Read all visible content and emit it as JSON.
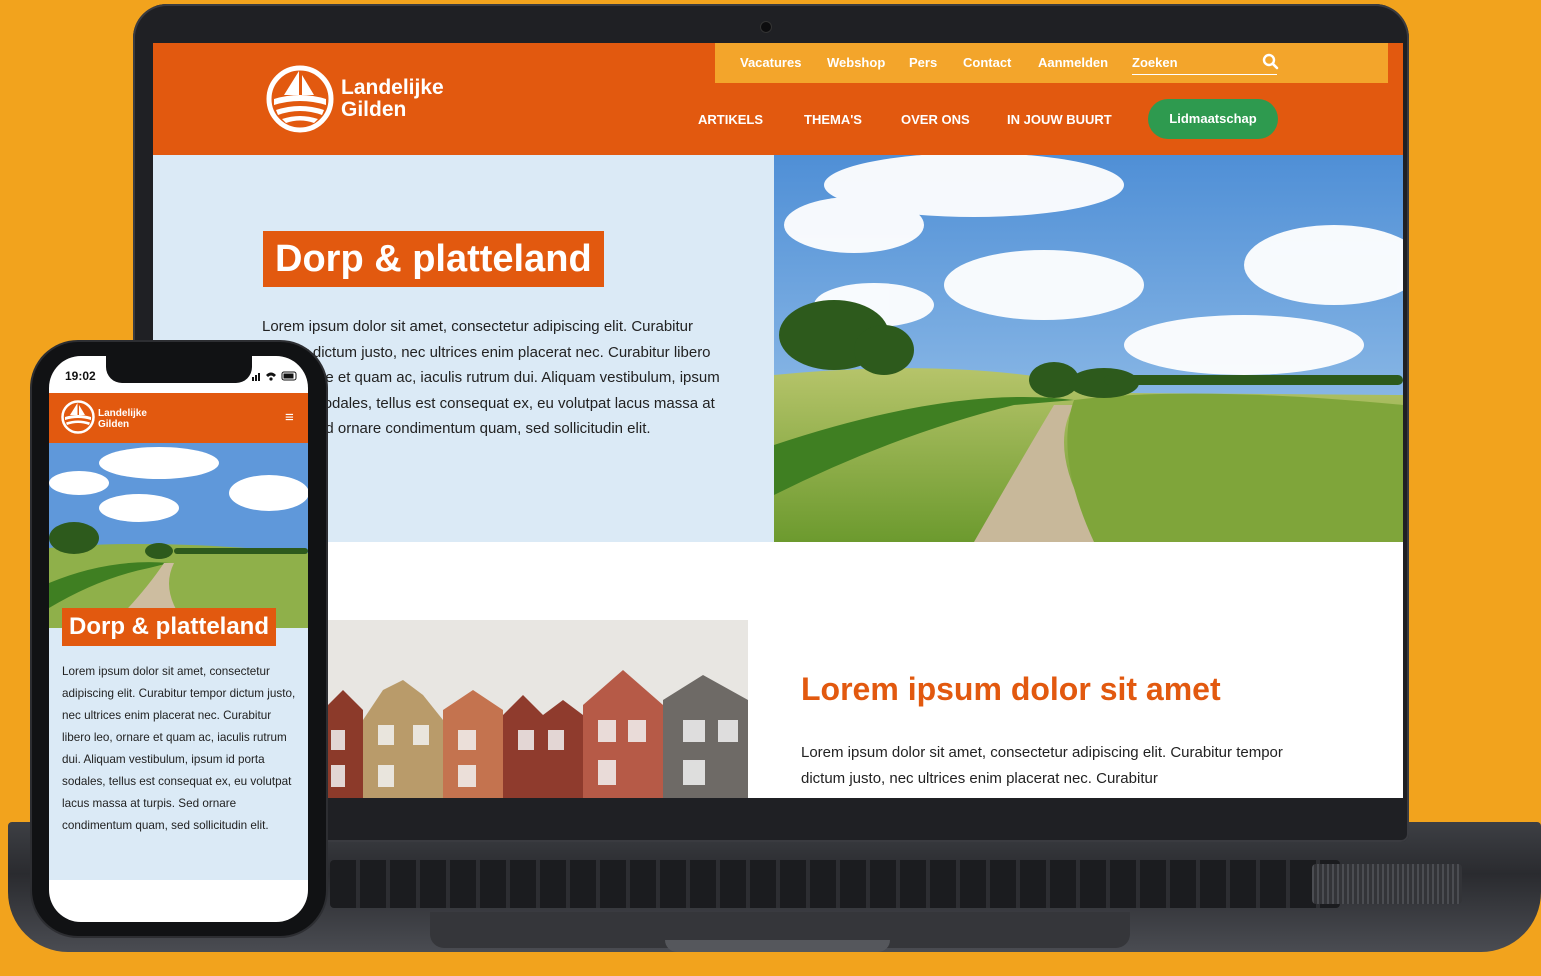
{
  "header": {
    "brand": [
      "Landelijke",
      "Gilden"
    ],
    "top_links": [
      "Vacatures",
      "Webshop",
      "Pers",
      "Contact",
      "Aanmelden"
    ],
    "search_placeholder": "Zoeken",
    "main_nav": [
      "ARTIKELS",
      "THEMA'S",
      "OVER ONS",
      "IN JOUW BUURT"
    ],
    "cta": "Lidmaatschap"
  },
  "hero": {
    "title": "Dorp & platteland",
    "text": "Lorem ipsum dolor sit amet, consectetur adipiscing elit. Curabitur tempor dictum justo, nec ultrices enim placerat nec. Curabitur libero leo, ornare et quam ac, iaculis rutrum dui. Aliquam vestibulum, ipsum id porta sodales, tellus est consequat ex, eu volutpat lacus massa at turpis. Sed ornare condimentum quam, sed sollicitudin elit."
  },
  "section": {
    "title": "Lorem ipsum dolor sit amet",
    "text": "Lorem ipsum dolor sit amet, consectetur adipiscing elit. Curabitur tempor dictum justo, nec ultrices enim placerat nec. Curabitur"
  },
  "phone": {
    "time": "19:02",
    "brand": [
      "Landelijke",
      "Gilden"
    ],
    "menu_icon": "≡",
    "title": "Dorp & platteland",
    "text": "Lorem ipsum dolor sit amet, consectetur adipiscing elit. Curabitur tempor dictum justo, nec ultrices enim placerat nec. Curabitur libero leo, ornare et quam ac, iaculis rutrum dui. Aliquam vestibulum, ipsum id porta sodales, tellus est consequat ex, eu volutpat lacus massa at turpis. Sed ornare condimentum quam, sed sollicitudin elit."
  },
  "colors": {
    "background": "#f2a31d",
    "brand_orange": "#e2590f",
    "topbar_yellow": "#f3a52b",
    "cta_green": "#2e9a4f",
    "hero_panel": "#dbeaf6"
  }
}
